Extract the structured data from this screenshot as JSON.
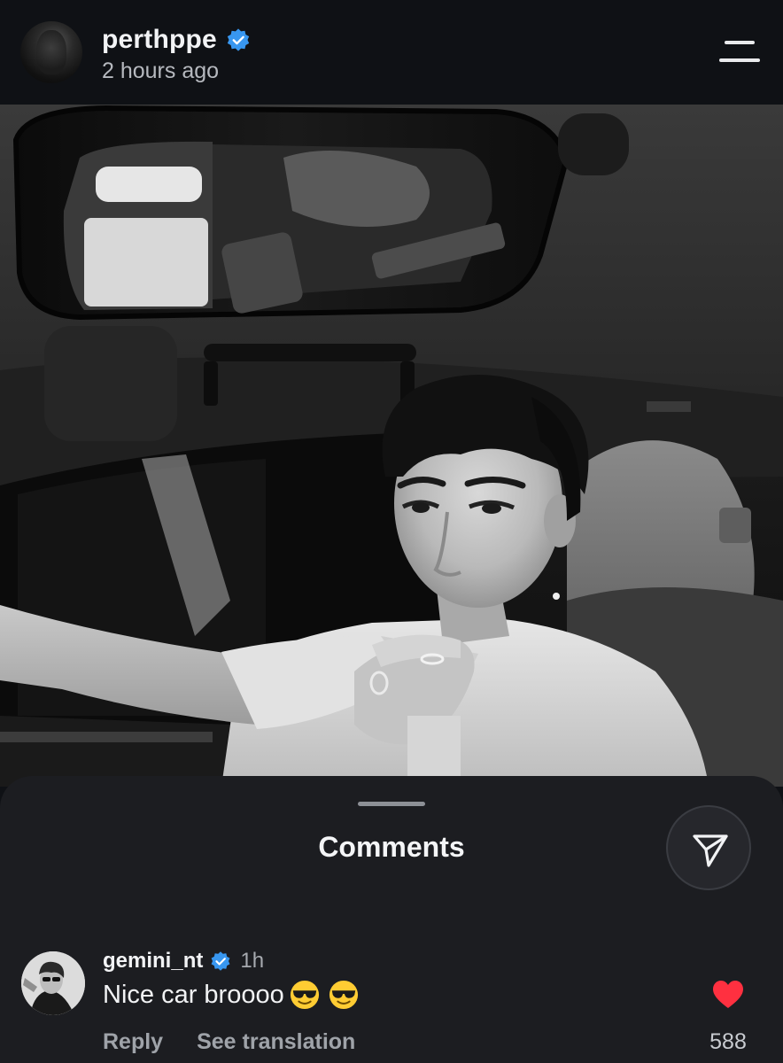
{
  "post": {
    "username": "perthppe",
    "verified": true,
    "timestamp": "2 hours ago"
  },
  "photo": {
    "description_icon": "photo-image",
    "tone": "black-and-white"
  },
  "comments_sheet": {
    "title": "Comments"
  },
  "comments": [
    {
      "username": "gemini_nt",
      "verified": true,
      "time": "1h",
      "text": "Nice car broooo",
      "emojis": [
        "sunglasses-emoji",
        "sunglasses-emoji"
      ],
      "reply_label": "Reply",
      "translate_label": "See translation",
      "liked": true,
      "like_count": "588"
    }
  ],
  "colors": {
    "background": "#0f1115",
    "sheet": "#1c1d21",
    "verified_blue": "#3897f0",
    "like_red": "#ff3040"
  }
}
